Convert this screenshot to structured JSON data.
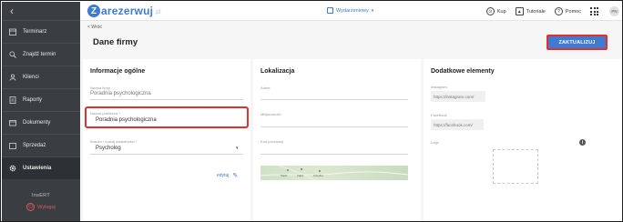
{
  "sidebar": {
    "back_glyph": "‹",
    "items": [
      {
        "label": "Terminarz",
        "icon": "calendar-icon"
      },
      {
        "label": "Znajdź termin",
        "icon": "search-icon"
      },
      {
        "label": "Klienci",
        "icon": "users-icon"
      },
      {
        "label": "Raporty",
        "icon": "reports-icon"
      },
      {
        "label": "Dokumenty",
        "icon": "documents-icon"
      },
      {
        "label": "Sprzedaż",
        "icon": "cart-icon"
      },
      {
        "label": "Ustawienia",
        "icon": "gear-icon",
        "active": true
      }
    ],
    "brand": "InsERT",
    "logout": "Wyloguj"
  },
  "topbar": {
    "logo_letter": "Z",
    "logo_word": "arezerwuj",
    "logo_tld": ".pl",
    "calendar_label": "Wydarzeniowy",
    "buy": "Kup",
    "tutorials": "Tutoriale",
    "help": "Pomoc",
    "avatar_initials": "PN"
  },
  "page": {
    "back_link": "< Wróć",
    "title": "Dane firmy",
    "update_button": "ZAKTUALIZUJ"
  },
  "general": {
    "title": "Informacje ogólne",
    "company_name_label": "Nazwa firmy",
    "company_name_value": "Poradnia psychologiczna",
    "public_name_label": "Nazwa publiczna *",
    "public_name_value": "Poradnia psychologiczna",
    "industry_label": "Branża / rodzaj działalności *",
    "industry_value": "Psycholog",
    "edit_link": "edytuj"
  },
  "location": {
    "title": "Lokalizacja",
    "address_label": "Adres",
    "city_label": "Miejscowość",
    "postal_label": "Kod pocztowy",
    "map_labels": [
      "Marki",
      "Ząbki",
      "Kobyłka"
    ]
  },
  "extras": {
    "title": "Dodatkowe elementy",
    "instagram_label": "Instagram",
    "instagram_placeholder": "https://instagram.com/",
    "facebook_label": "Facebook",
    "facebook_placeholder": "https://facebook.com/",
    "logo_label": "Logo",
    "info_glyph": "i"
  },
  "colors": {
    "accent": "#3e7bd1",
    "highlight": "#e03030",
    "sidebar": "#3a3d42"
  }
}
